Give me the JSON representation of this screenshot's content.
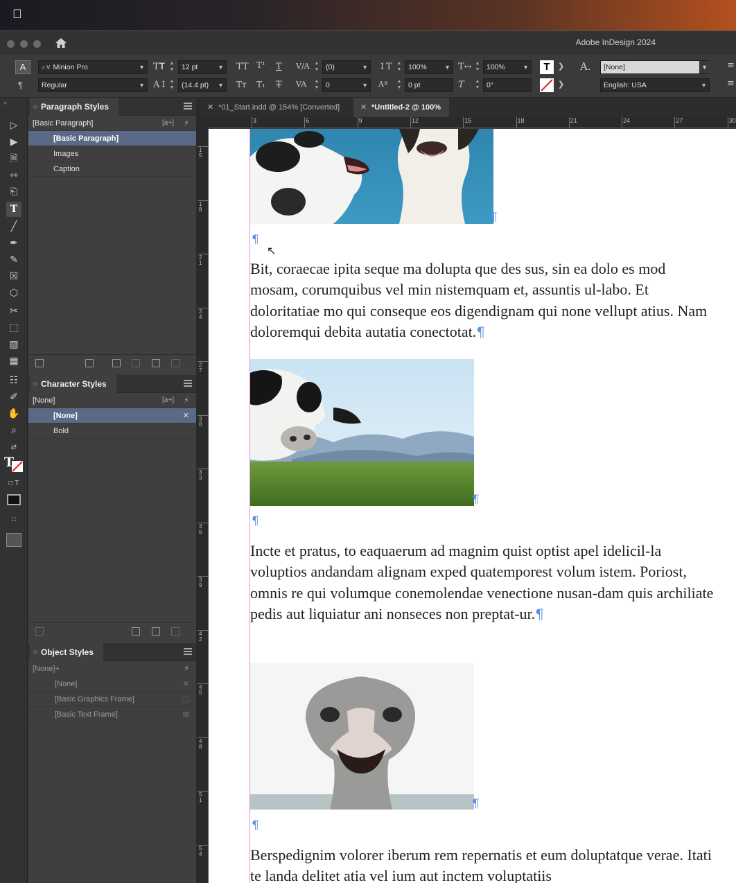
{
  "app": {
    "title": "Adobe InDesign 2024"
  },
  "control_panel": {
    "font_family": "Minion Pro",
    "font_style": "Regular",
    "font_size": "12 pt",
    "leading": "(14.4 pt)",
    "kerning": "(0)",
    "tracking": "0",
    "vertical_scale": "100%",
    "horizontal_scale": "100%",
    "baseline_shift": "0 pt",
    "skew": "0°",
    "char_style": "[None]",
    "language": "English: USA"
  },
  "paragraph_styles": {
    "title": "Paragraph Styles",
    "current": "[Basic Paragraph]",
    "new_style_marker": "[a+]",
    "items": [
      {
        "label": "[Basic Paragraph]",
        "selected": true
      },
      {
        "label": "Images",
        "selected": false
      },
      {
        "label": "Caption",
        "selected": false
      }
    ]
  },
  "character_styles": {
    "title": "Character Styles",
    "current": "[None]",
    "new_style_marker": "[a+]",
    "items": [
      {
        "label": "[None]",
        "selected": true
      },
      {
        "label": "Bold",
        "selected": false
      }
    ]
  },
  "object_styles": {
    "title": "Object Styles",
    "current": "[None]+",
    "items": [
      {
        "label": "[None]"
      },
      {
        "label": "[Basic Graphics Frame]"
      },
      {
        "label": "[Basic Text Frame]"
      }
    ]
  },
  "doc_tabs": [
    {
      "label": "*01_Start.indd @ 154% [Converted]",
      "active": false
    },
    {
      "label": "*Untitled-2 @ 100%",
      "active": true
    }
  ],
  "ruler": {
    "h_labels": [
      "3",
      "6",
      "9",
      "12",
      "15",
      "18",
      "21",
      "24",
      "27",
      "30"
    ],
    "v_labels": [
      "15",
      "18",
      "21",
      "24",
      "27",
      "30",
      "33",
      "36",
      "39",
      "42",
      "45",
      "48",
      "51",
      "54"
    ]
  },
  "document": {
    "paragraph_1": "Bit, coraecae ipita seque ma dolupta que des sus, sin ea dolo es mod mosam, corumquibus vel min nistemquam et, assuntis ul-labo. Et doloritatiae mo qui conseque eos digendignam qui none vellupt atius. Nam doloremqui debita autatia conectotat.",
    "paragraph_2": "Incte et pratus, to eaquaerum ad magnim quist optist apel idelicil-la voluptios andandam alignam exped quatemporest volum istem. Poriost, omnis re qui volumque conemolendae venectione nusan-dam quis archiliate pedis aut liquiatur ani nonseces non preptat-ur.",
    "paragraph_3": "Berspedignim volorer iberum rem repernatis et eum doluptatque verae. Itati te landa delitet atia vel ium aut inctem voluptatiis",
    "pilcrow": "¶"
  },
  "colors": {
    "selection": "#5a6a86",
    "margin_guide": "#e48de0",
    "hidden_chars": "#5b8fe8"
  }
}
